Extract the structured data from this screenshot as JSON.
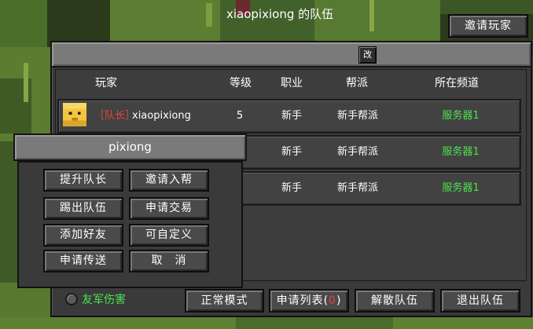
{
  "invite_button": "邀请玩家",
  "team": {
    "title": "xiaopixiong 的队伍",
    "rename_button": "改",
    "columns": [
      "玩家",
      "等级",
      "职业",
      "帮派",
      "所在频道"
    ],
    "rows": [
      {
        "tag": "［队长］",
        "name": "xiaopixiong",
        "level": "5",
        "job": "新手",
        "guild": "新手帮派",
        "channel": "服务器1"
      },
      {
        "tag": "",
        "name": "",
        "level": "",
        "job": "新手",
        "guild": "新手帮派",
        "channel": "服务器1"
      },
      {
        "tag": "",
        "name": "",
        "level": "",
        "job": "新手",
        "guild": "新手帮派",
        "channel": "服务器1"
      }
    ]
  },
  "context_menu": {
    "title": "pixiong",
    "buttons": [
      "提升队长",
      "邀请入帮",
      "踢出队伍",
      "申请交易",
      "添加好友",
      "可自定义",
      "申请传送",
      "取　消"
    ]
  },
  "bottom": {
    "friendly_fire": "友军伤害",
    "mode_button": "正常模式",
    "apply_list_label": "申请列表",
    "apply_list_paren_open": "(",
    "apply_list_count": "0",
    "apply_list_paren_close": ")",
    "disband_button": "解散队伍",
    "leave_button": "退出队伍"
  },
  "colors": {
    "channel": "#4ce34c",
    "leader_tag": "#e8453b",
    "friendly_fire": "#4ce34c",
    "apply_count": "#e8453b"
  }
}
